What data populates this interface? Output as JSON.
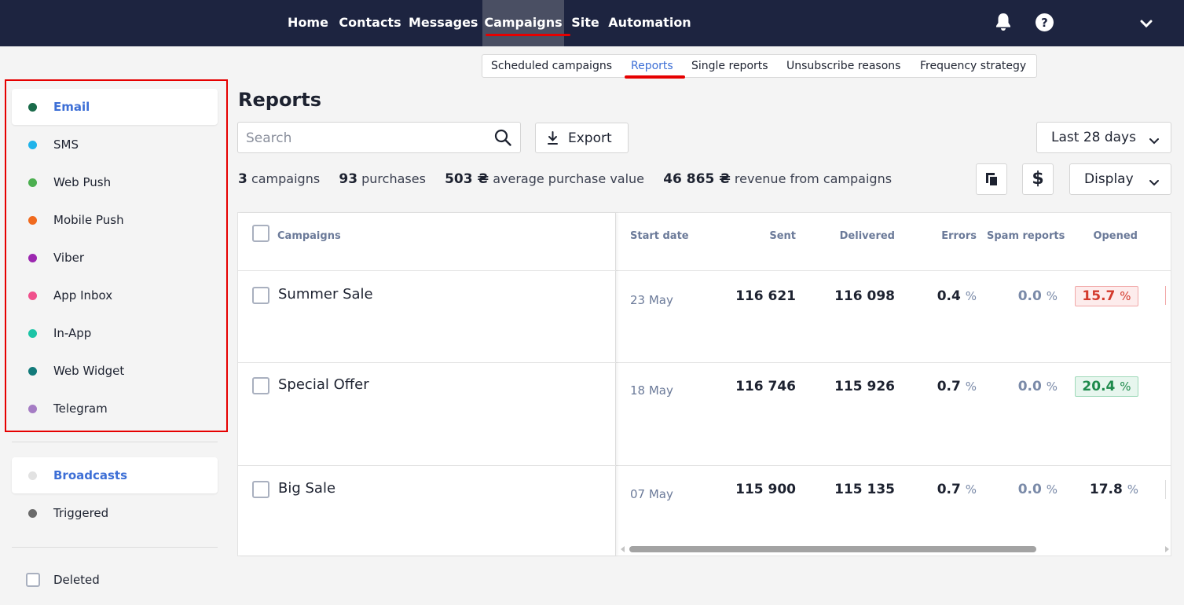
{
  "nav": {
    "items": [
      "Home",
      "Contacts",
      "Messages",
      "Campaigns",
      "Site",
      "Automation"
    ],
    "active": "Campaigns",
    "icons": [
      "bell-icon",
      "help-icon",
      "chevron-down-icon"
    ]
  },
  "subnav": {
    "items": [
      "Scheduled campaigns",
      "Reports",
      "Single reports",
      "Unsubscribe reasons",
      "Frequency strategy"
    ],
    "active": "Reports"
  },
  "sidebar": {
    "channels": [
      {
        "label": "Email",
        "color": "#1a6b4a",
        "active": true
      },
      {
        "label": "SMS",
        "color": "#1fb3ea"
      },
      {
        "label": "Web Push",
        "color": "#4caf50"
      },
      {
        "label": "Mobile Push",
        "color": "#f06a1e"
      },
      {
        "label": "Viber",
        "color": "#9c27b0"
      },
      {
        "label": "App Inbox",
        "color": "#f0508c"
      },
      {
        "label": "In-App",
        "color": "#1cc4a6"
      },
      {
        "label": "Web Widget",
        "color": "#127a7a"
      },
      {
        "label": "Telegram",
        "color": "#a57cc4"
      }
    ],
    "types": [
      {
        "label": "Broadcasts",
        "color": "#e2e2e2",
        "active": true
      },
      {
        "label": "Triggered",
        "color": "#6a6a6a"
      }
    ],
    "deleted_label": "Deleted"
  },
  "main": {
    "title": "Reports",
    "search_placeholder": "Search",
    "export_label": "Export",
    "period_label": "Last 28 days",
    "display_label": "Display",
    "summary": {
      "campaigns_count": "3",
      "campaigns_label": "campaigns",
      "purchases_count": "93",
      "purchases_label": "purchases",
      "avg_value": "503 ₴",
      "avg_label": "average purchase value",
      "revenue": "46 865 ₴",
      "revenue_label": "revenue from campaigns"
    },
    "toolbar_icons": [
      "copy-icon",
      "dollar-icon"
    ],
    "dollar_glyph": "$"
  },
  "table": {
    "headers": {
      "campaigns": "Campaigns",
      "start_date": "Start date",
      "sent": "Sent",
      "delivered": "Delivered",
      "errors": "Errors",
      "spam": "Spam reports",
      "opened": "Opened"
    },
    "percent_sign": "%",
    "rows": [
      {
        "name": "Summer Sale",
        "date": "23 May",
        "sent": "116 621",
        "delivered": "116 098",
        "errors": "0.4",
        "spam": "0.0",
        "opened": "15.7",
        "opened_style": "red"
      },
      {
        "name": "Special Offer",
        "date": "18 May",
        "sent": "116 746",
        "delivered": "115 926",
        "errors": "0.7",
        "spam": "0.0",
        "opened": "20.4",
        "opened_style": "green"
      },
      {
        "name": "Big Sale",
        "date": "07 May",
        "sent": "115 900",
        "delivered": "115 135",
        "errors": "0.7",
        "spam": "0.0",
        "opened": "17.8",
        "opened_style": "plain"
      }
    ],
    "scroll_position": 0.02
  },
  "colors": {
    "topbar": "#1d2440",
    "accent_red": "#e60000",
    "link_blue": "#3d6fd6"
  }
}
